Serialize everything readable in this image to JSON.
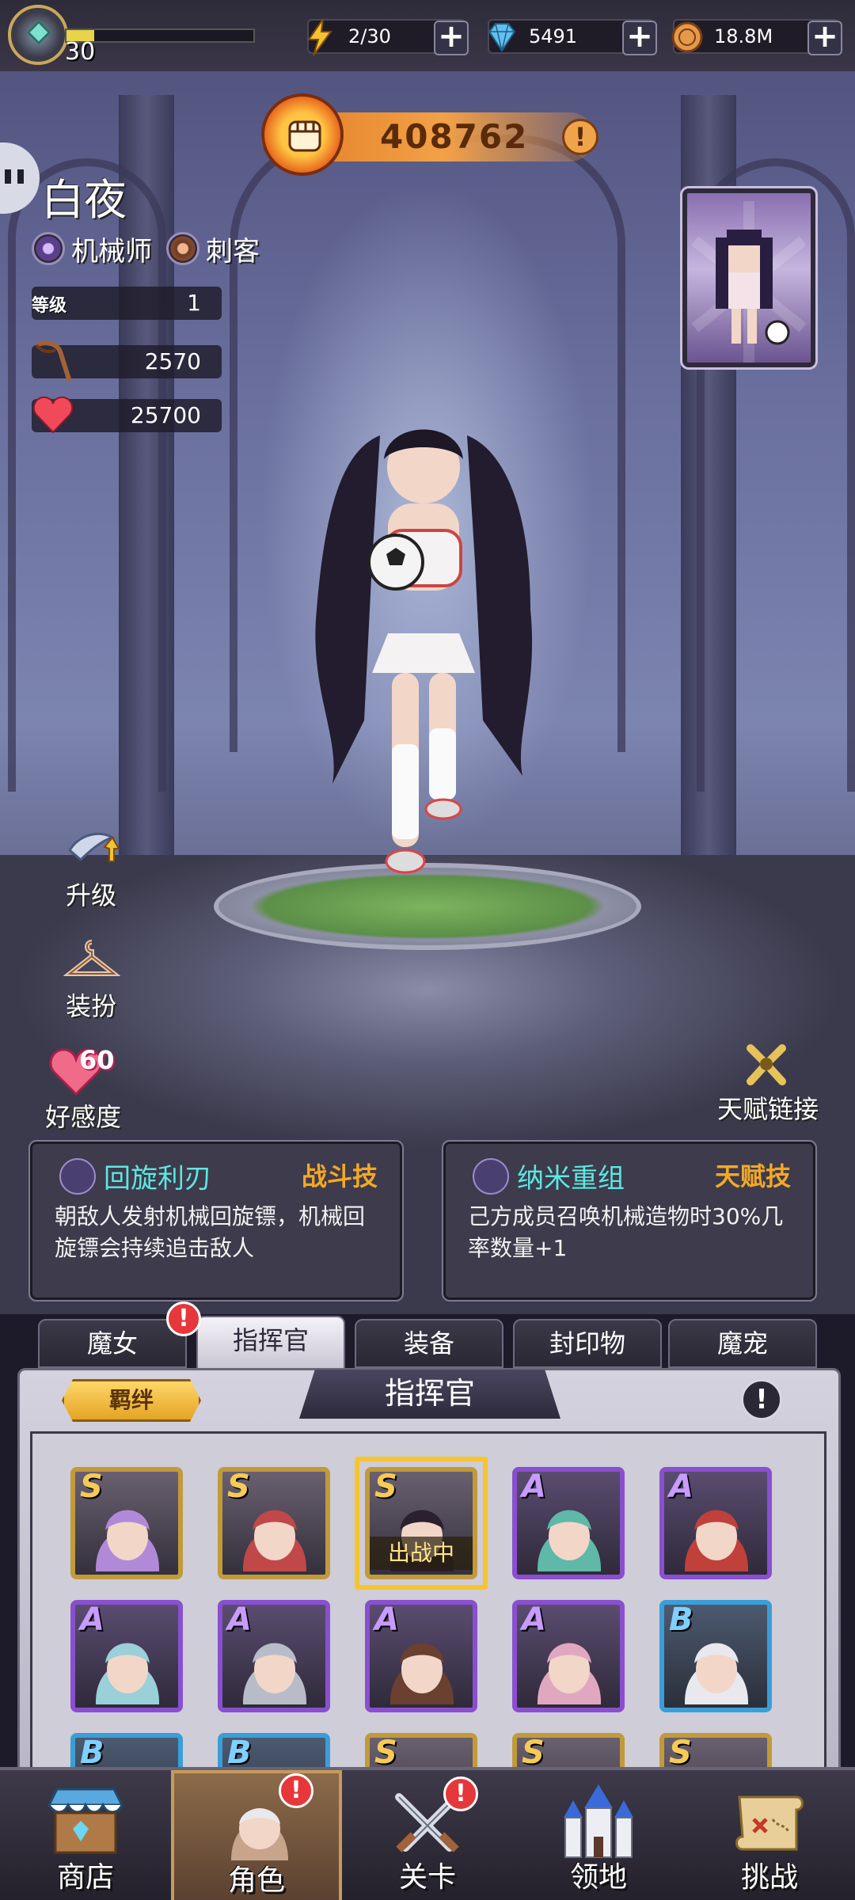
{
  "topbar": {
    "player_level": "30",
    "xp_fraction": 0.15,
    "energy": "2/30",
    "gems": "5491",
    "gold": "18.8M"
  },
  "power": {
    "value": "408762",
    "info": "!"
  },
  "character": {
    "name": "白夜",
    "class_tags": [
      "机械师",
      "刺客"
    ],
    "stats": {
      "level_label": "等级",
      "level": "1",
      "attack": "2570",
      "hp": "25700"
    }
  },
  "side_buttons": {
    "upgrade": "升级",
    "dress": "装扮",
    "affection": "好感度",
    "affection_value": "60",
    "talent_link": "天赋链接"
  },
  "skills": [
    {
      "name": "回旋利刃",
      "type": "战斗技",
      "desc": "朝敌人发射机械回旋镖，机械回旋镖会持续追击敌人"
    },
    {
      "name": "纳米重组",
      "type": "天赋技",
      "desc": "己方成员召唤机械造物时30%几率数量+1"
    }
  ],
  "tabs": [
    "魔女",
    "指挥官",
    "装备",
    "封印物",
    "魔宠"
  ],
  "tab_badge": "!",
  "panel": {
    "title": "指挥官",
    "bond_label": "羁绊",
    "info": "!",
    "deployed_label": "出战中"
  },
  "commanders": [
    {
      "rank": "S"
    },
    {
      "rank": "S"
    },
    {
      "rank": "S",
      "deployed": true
    },
    {
      "rank": "A"
    },
    {
      "rank": "A"
    },
    {
      "rank": "A"
    },
    {
      "rank": "A"
    },
    {
      "rank": "A"
    },
    {
      "rank": "A"
    },
    {
      "rank": "B"
    },
    {
      "rank": "B"
    },
    {
      "rank": "B"
    },
    {
      "rank": "S"
    },
    {
      "rank": "S"
    },
    {
      "rank": "S"
    }
  ],
  "bottom_nav": [
    "商店",
    "角色",
    "关卡",
    "领地",
    "挑战"
  ],
  "colors": {
    "accent_cyan": "#5ee7e0",
    "accent_orange": "#f3a826",
    "rank_s": "#c19a3a",
    "rank_a": "#8a4fcf",
    "rank_b": "#3a9ed8",
    "badge_red": "#e6373a"
  }
}
